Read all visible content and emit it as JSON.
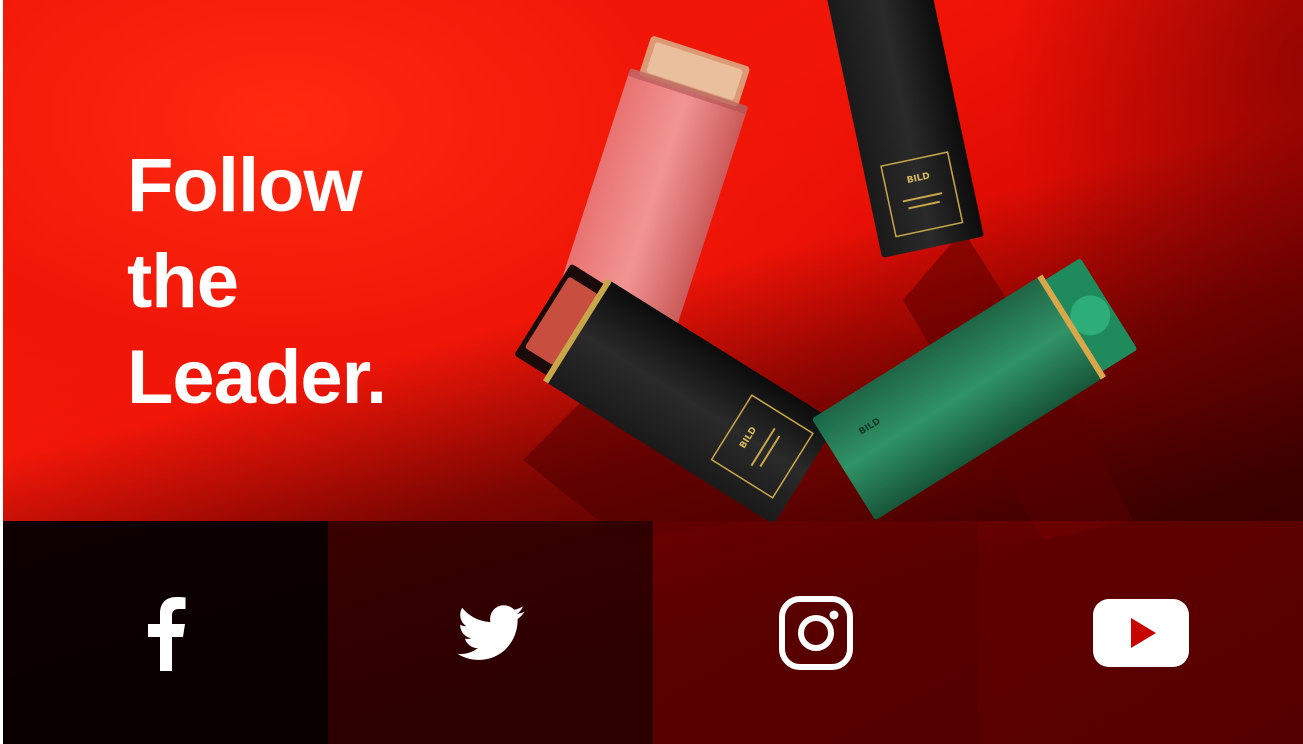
{
  "hero": {
    "headline_lines": [
      "Follow",
      "the",
      "Leader."
    ]
  },
  "products": {
    "brand_mark": "BILD"
  },
  "social": {
    "items": [
      {
        "name": "facebook",
        "icon": "facebook-icon"
      },
      {
        "name": "twitter",
        "icon": "twitter-icon"
      },
      {
        "name": "instagram",
        "icon": "instagram-icon"
      },
      {
        "name": "youtube",
        "icon": "youtube-icon"
      }
    ]
  },
  "colors": {
    "background_red": "#ee1206",
    "text": "#ffffff",
    "youtube_play": "#c80400"
  }
}
